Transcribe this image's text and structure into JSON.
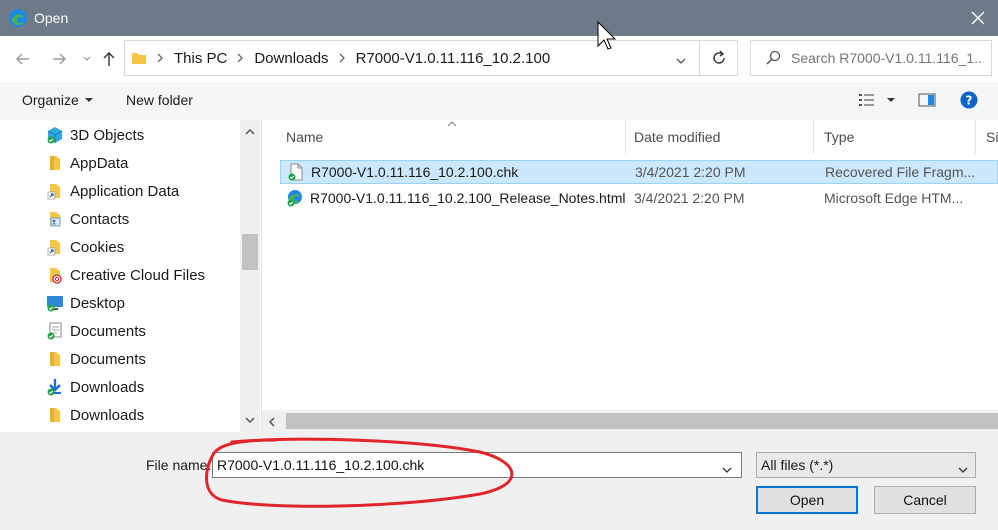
{
  "titlebar": {
    "title": "Open"
  },
  "address": {
    "breadcrumbs": [
      "This PC",
      "Downloads",
      "R7000-V1.0.11.116_10.2.100"
    ],
    "search_placeholder": "Search R7000-V1.0.11.116_1..."
  },
  "toolbar": {
    "organize_label": "Organize",
    "new_folder_label": "New folder"
  },
  "nav": {
    "items": [
      {
        "label": "3D Objects",
        "icon": "3d-objects-icon"
      },
      {
        "label": "AppData",
        "icon": "folder-icon"
      },
      {
        "label": "Application Data",
        "icon": "folder-shortcut-icon"
      },
      {
        "label": "Contacts",
        "icon": "contacts-folder-icon"
      },
      {
        "label": "Cookies",
        "icon": "folder-shortcut-icon"
      },
      {
        "label": "Creative Cloud Files",
        "icon": "creative-cloud-folder-icon"
      },
      {
        "label": "Desktop",
        "icon": "desktop-icon"
      },
      {
        "label": "Documents",
        "icon": "documents-icon"
      },
      {
        "label": "Documents",
        "icon": "folder-icon"
      },
      {
        "label": "Downloads",
        "icon": "downloads-icon"
      },
      {
        "label": "Downloads",
        "icon": "folder-icon"
      }
    ]
  },
  "filelist": {
    "columns": {
      "name": "Name",
      "date": "Date modified",
      "type": "Type",
      "size": "Siz"
    },
    "rows": [
      {
        "name": "R7000-V1.0.11.116_10.2.100.chk",
        "date": "3/4/2021 2:20 PM",
        "type": "Recovered File Fragm...",
        "selected": true
      },
      {
        "name": "R7000-V1.0.11.116_10.2.100_Release_Notes.html",
        "date": "3/4/2021 2:20 PM",
        "type": "Microsoft Edge HTM...",
        "selected": false
      }
    ]
  },
  "bottom": {
    "filename_label": "File name:",
    "filename_value": "R7000-V1.0.11.116_10.2.100.chk",
    "filetype_value": "All files (*.*)",
    "open_label": "Open",
    "cancel_label": "Cancel"
  },
  "colors": {
    "titlebar": "#6d7a87",
    "selection": "#cce8ff",
    "accent": "#0078d7",
    "annotation": "#e0262b"
  }
}
